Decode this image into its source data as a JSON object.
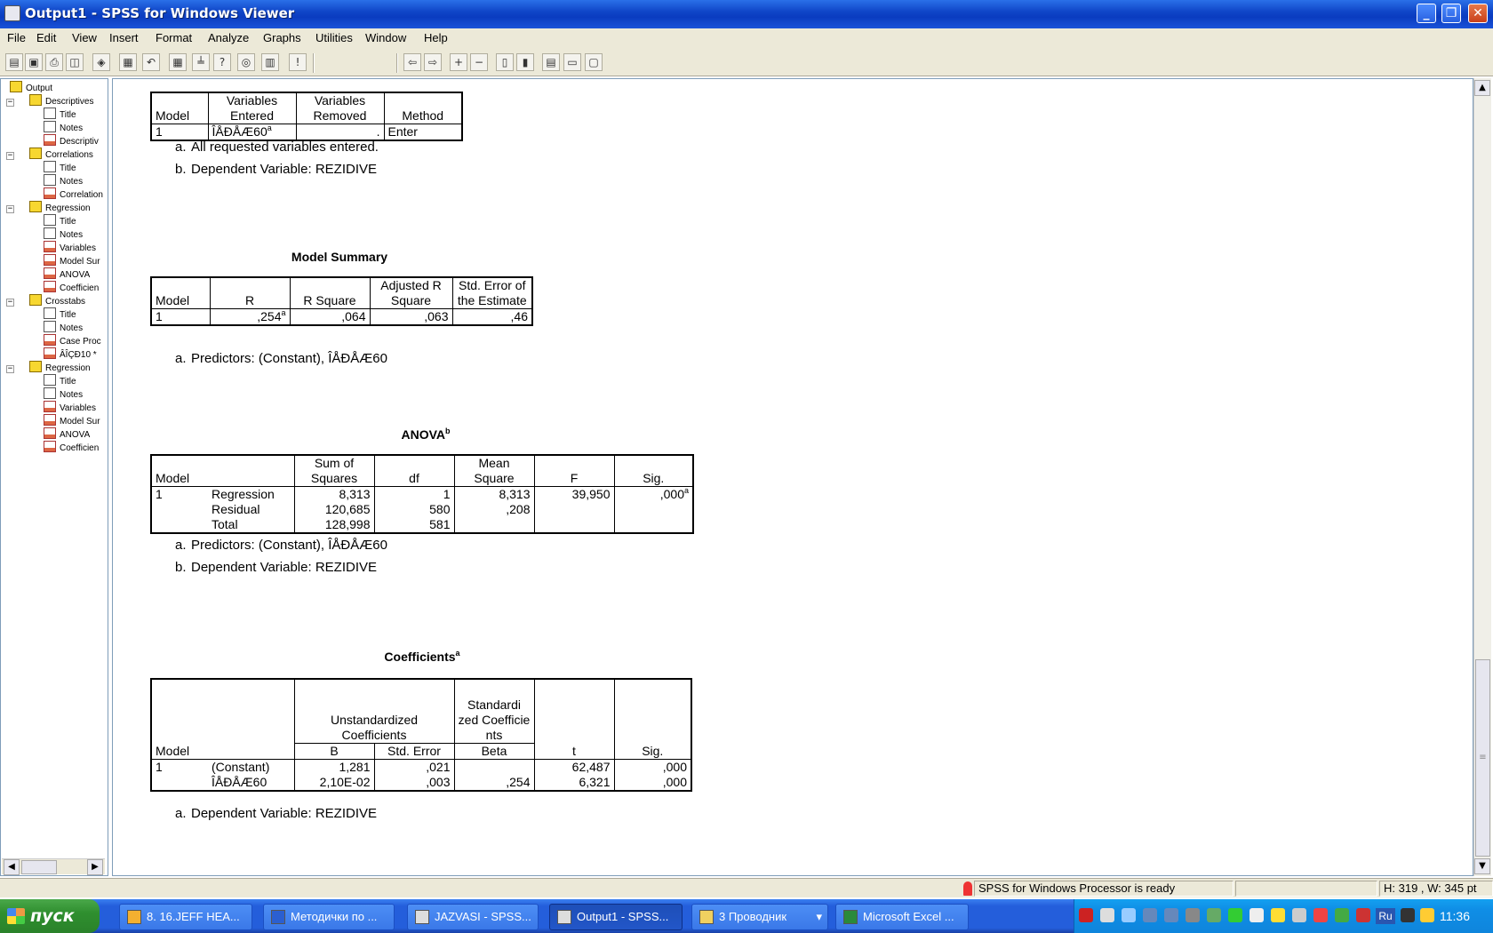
{
  "window": {
    "title": "Output1 - SPSS for Windows Viewer"
  },
  "menu": [
    "File",
    "Edit",
    "View",
    "Insert",
    "Format",
    "Analyze",
    "Graphs",
    "Utilities",
    "Window",
    "Help"
  ],
  "tree": [
    {
      "label": "Output",
      "icon": "book-icon",
      "level": 0
    },
    {
      "label": "Descriptives",
      "icon": "book-icon",
      "level": 1
    },
    {
      "label": "Title",
      "icon": "title-icon",
      "level": 2
    },
    {
      "label": "Notes",
      "icon": "notes-icon",
      "level": 2
    },
    {
      "label": "Descriptiv",
      "icon": "table-icon",
      "level": 2
    },
    {
      "label": "Correlations",
      "icon": "book-icon",
      "level": 1
    },
    {
      "label": "Title",
      "icon": "title-icon",
      "level": 2
    },
    {
      "label": "Notes",
      "icon": "notes-icon",
      "level": 2
    },
    {
      "label": "Correlation",
      "icon": "table-icon",
      "level": 2
    },
    {
      "label": "Regression",
      "icon": "book-icon",
      "level": 1
    },
    {
      "label": "Title",
      "icon": "title-icon",
      "level": 2
    },
    {
      "label": "Notes",
      "icon": "notes-icon",
      "level": 2
    },
    {
      "label": "Variables",
      "icon": "table-icon",
      "level": 2
    },
    {
      "label": "Model Sur",
      "icon": "table-icon",
      "level": 2
    },
    {
      "label": "ANOVA",
      "icon": "table-icon",
      "level": 2
    },
    {
      "label": "Coefficien",
      "icon": "table-icon",
      "level": 2
    },
    {
      "label": "Crosstabs",
      "icon": "book-icon",
      "level": 1
    },
    {
      "label": "Title",
      "icon": "title-icon",
      "level": 2
    },
    {
      "label": "Notes",
      "icon": "notes-icon",
      "level": 2
    },
    {
      "label": "Case Proc",
      "icon": "table-icon",
      "level": 2
    },
    {
      "label": "ÂÎÇÐ10 *",
      "icon": "table-icon",
      "level": 2
    },
    {
      "label": "Regression",
      "icon": "book-icon",
      "level": 1
    },
    {
      "label": "Title",
      "icon": "title-icon",
      "level": 2
    },
    {
      "label": "Notes",
      "icon": "notes-icon",
      "level": 2
    },
    {
      "label": "Variables",
      "icon": "table-icon",
      "level": 2
    },
    {
      "label": "Model Sur",
      "icon": "table-icon",
      "level": 2
    },
    {
      "label": "ANOVA",
      "icon": "table-icon",
      "level": 2
    },
    {
      "label": "Coefficien",
      "icon": "table-icon",
      "level": 2
    }
  ],
  "vars_table": {
    "h_model": "Model",
    "h_entered": "Variables Entered",
    "h_removed": "Variables Removed",
    "h_method": "Method",
    "model": "1",
    "entered": "ÎÅÐÅÆ60",
    "entered_sup": "a",
    "removed": ".",
    "method": "Enter",
    "fn_a_key": "a.",
    "fn_a": "All requested variables entered.",
    "fn_b_key": "b.",
    "fn_b": "Dependent Variable: REZIDIVE"
  },
  "model_summary": {
    "title": "Model Summary",
    "h_model": "Model",
    "h_r": "R",
    "h_rsq": "R Square",
    "h_adj": "Adjusted R Square",
    "h_se": "Std. Error of the Estimate",
    "model": "1",
    "r": ",254",
    "r_sup": "a",
    "rsq": ",064",
    "adj": ",063",
    "se": ",46",
    "fn_a_key": "a.",
    "fn_a": "Predictors: (Constant), ÎÅÐÅÆ60"
  },
  "anova": {
    "title": "ANOVA",
    "title_sup": "b",
    "h_model": "Model",
    "h_ss": "Sum of Squares",
    "h_df": "df",
    "h_ms": "Mean Square",
    "h_f": "F",
    "h_sig": "Sig.",
    "model": "1",
    "rows": [
      {
        "label": "Regression",
        "ss": "8,313",
        "df": "1",
        "ms": "8,313",
        "f": "39,950",
        "sig": ",000",
        "sig_sup": "a"
      },
      {
        "label": "Residual",
        "ss": "120,685",
        "df": "580",
        "ms": ",208",
        "f": "",
        "sig": "",
        "sig_sup": ""
      },
      {
        "label": "Total",
        "ss": "128,998",
        "df": "581",
        "ms": "",
        "f": "",
        "sig": "",
        "sig_sup": ""
      }
    ],
    "fn_a_key": "a.",
    "fn_a": "Predictors: (Constant), ÎÅÐÅÆ60",
    "fn_b_key": "b.",
    "fn_b": "Dependent Variable: REZIDIVE"
  },
  "coefficients": {
    "title": "Coefficients",
    "title_sup": "a",
    "h_model": "Model",
    "h_unstd": "Unstandardized Coefficients",
    "h_std": "Standardi zed Coefficie nts",
    "h_b": "B",
    "h_se": "Std. Error",
    "h_beta": "Beta",
    "h_t": "t",
    "h_sig": "Sig.",
    "model": "1",
    "rows": [
      {
        "label": "(Constant)",
        "b": "1,281",
        "se": ",021",
        "beta": "",
        "t": "62,487",
        "sig": ",000"
      },
      {
        "label": "ÎÅÐÅÆ60",
        "b": "2,10E-02",
        "se": ",003",
        "beta": ",254",
        "t": "6,321",
        "sig": ",000"
      }
    ],
    "fn_a_key": "a.",
    "fn_a": "Dependent Variable: REZIDIVE"
  },
  "status": {
    "message": "SPSS for Windows Processor is ready",
    "dims": "H: 319 , W: 345  pt"
  },
  "taskbar": {
    "start": "пуск",
    "tasks": [
      "8. 16.JEFF HEA...",
      "Методички по ...",
      "JAZVASI - SPSS...",
      "Output1 - SPSS...",
      "3 Проводник",
      "Microsoft Excel ..."
    ],
    "lang": "Ru",
    "clock": "11:36"
  }
}
